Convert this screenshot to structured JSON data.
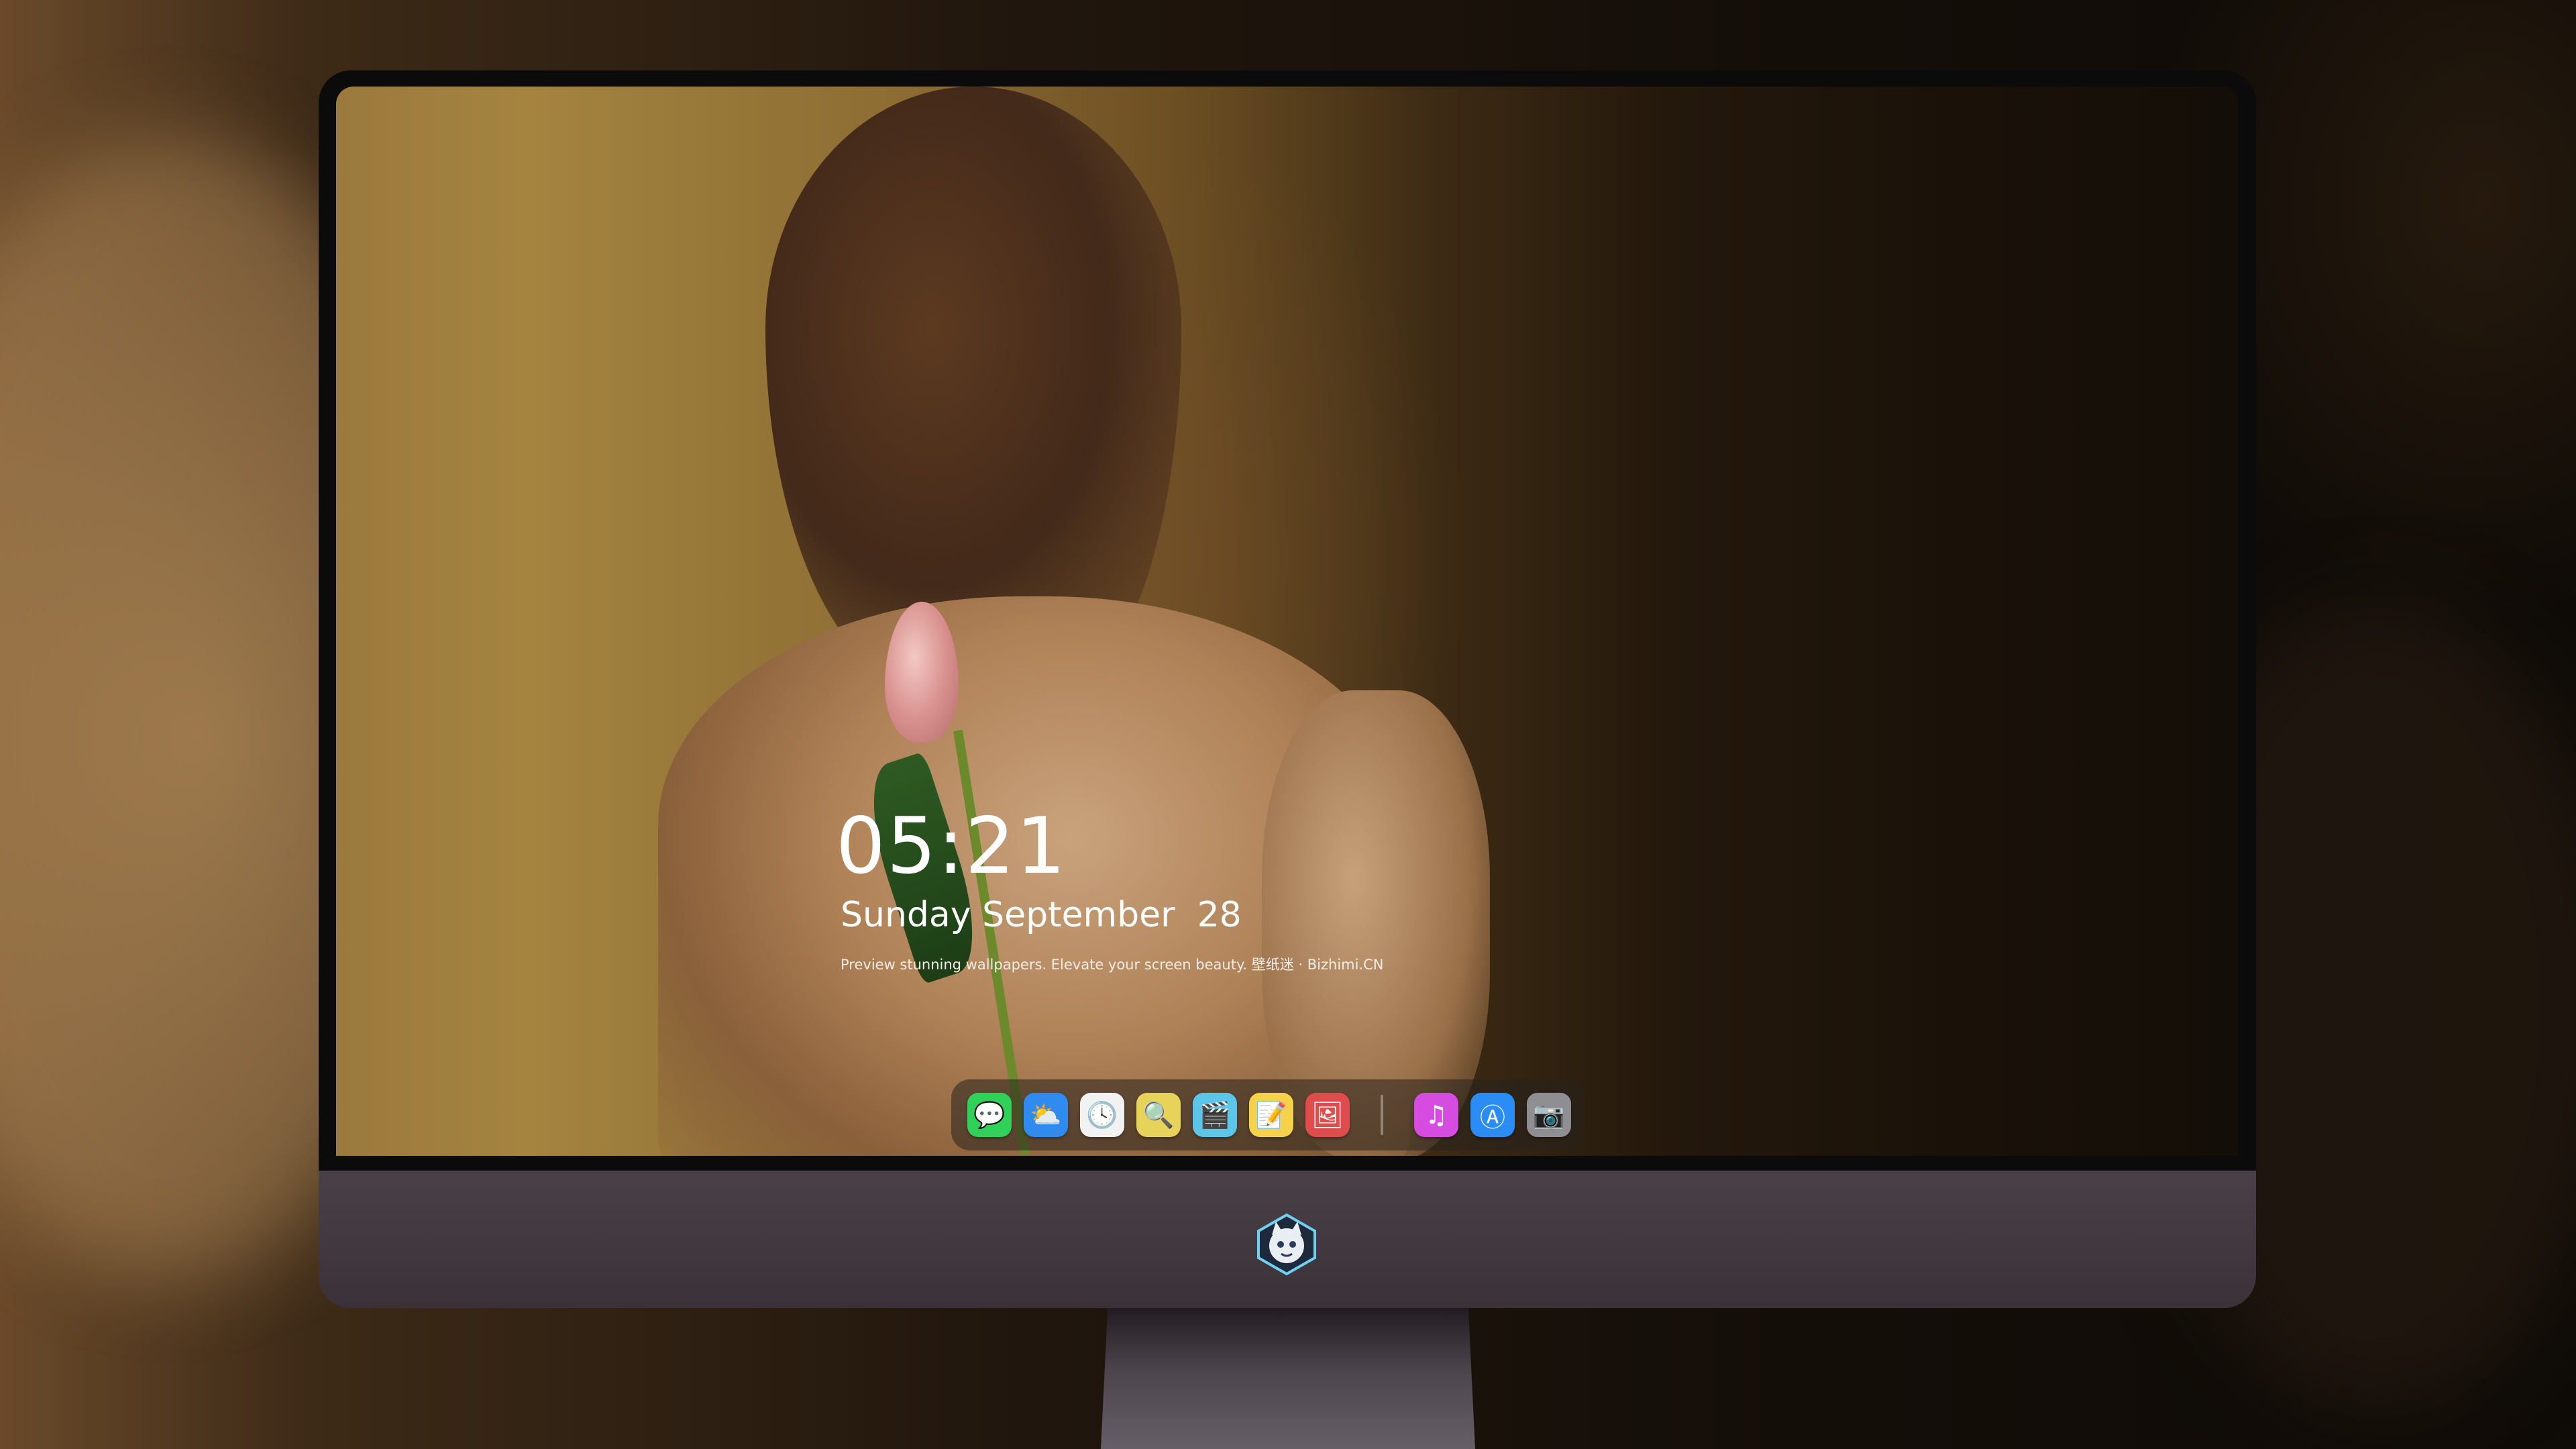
{
  "lock_screen": {
    "time": "05:21",
    "date": "Sunday September  28",
    "tagline": "Preview stunning wallpapers. Elevate your screen beauty. 壁纸迷 · Bizhimi.CN"
  },
  "dock": {
    "apps": [
      {
        "name": "messages-icon",
        "glyph": "💬",
        "color": "#2fd158"
      },
      {
        "name": "weather-icon",
        "glyph": "⛅",
        "color": "#2f8bf0"
      },
      {
        "name": "clock-icon",
        "glyph": "🕓",
        "color": "#f2f2f2"
      },
      {
        "name": "preview-icon",
        "glyph": "🔍",
        "color": "#e8d35a"
      },
      {
        "name": "clips-icon",
        "glyph": "🎬",
        "color": "#5cc6e8"
      },
      {
        "name": "notes-icon",
        "glyph": "📝",
        "color": "#f6d24a"
      },
      {
        "name": "photo-booth-icon",
        "glyph": "🖼",
        "color": "#e04b4b"
      },
      {
        "name": "music-icon",
        "glyph": "♫",
        "color": "#d64be0"
      },
      {
        "name": "app-store-icon",
        "glyph": "Ⓐ",
        "color": "#2a8cf5"
      },
      {
        "name": "camera-icon",
        "glyph": "📷",
        "color": "#8e8e93"
      }
    ]
  },
  "monitor": {
    "brand_logo": "bizhimi-mascot-logo"
  }
}
